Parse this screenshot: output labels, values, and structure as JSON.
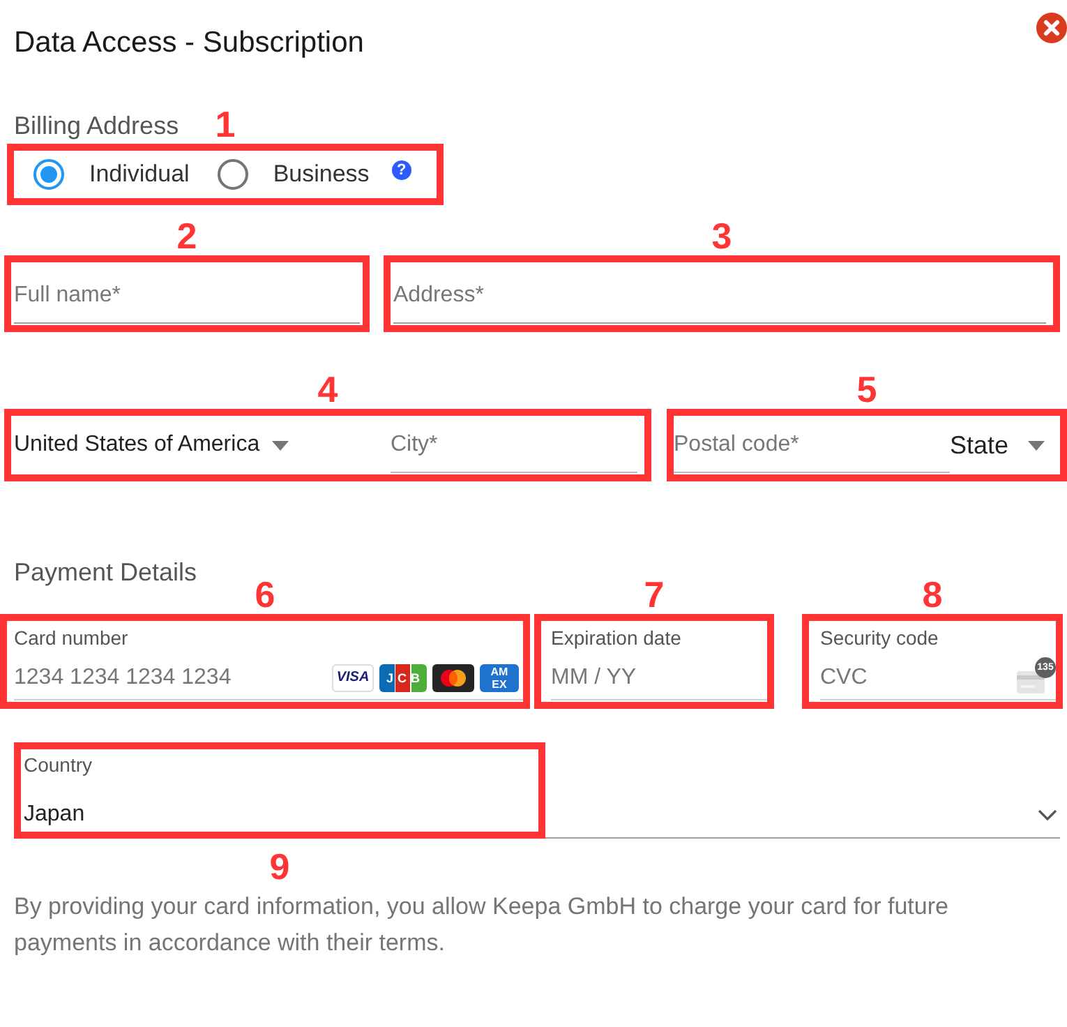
{
  "dialog": {
    "title": "Data Access - Subscription"
  },
  "billing": {
    "heading": "Billing Address",
    "annotation": "1",
    "types": [
      {
        "label": "Individual",
        "selected": true
      },
      {
        "label": "Business",
        "selected": false
      }
    ],
    "help": "?"
  },
  "address_rows": [
    {
      "groups": [
        {
          "annotation": "2",
          "fields": [
            {
              "kind": "text",
              "placeholder": "Full name*"
            }
          ]
        },
        {
          "annotation": "3",
          "fields": [
            {
              "kind": "text",
              "placeholder": "Address*"
            }
          ]
        }
      ]
    },
    {
      "groups": [
        {
          "annotation": "4",
          "fields": [
            {
              "kind": "select",
              "value": "United States of America"
            },
            {
              "kind": "text",
              "placeholder": "City*"
            }
          ]
        },
        {
          "annotation": "5",
          "fields": [
            {
              "kind": "text",
              "placeholder": "Postal code*"
            },
            {
              "kind": "select",
              "value": "State"
            }
          ]
        }
      ]
    }
  ],
  "payment": {
    "heading": "Payment Details",
    "fields": [
      {
        "kind": "card",
        "label": "Card number",
        "placeholder": "1234 1234 1234 1234",
        "annotation": "6",
        "brands": [
          {
            "kind": "visa",
            "text": "VISA"
          },
          {
            "kind": "jcb",
            "text": "JCB"
          },
          {
            "kind": "mastercard"
          },
          {
            "kind": "amex",
            "text": "AMEX"
          }
        ]
      },
      {
        "kind": "expiry",
        "label": "Expiration date",
        "placeholder": "MM / YY",
        "annotation": "7"
      },
      {
        "kind": "cvc",
        "label": "Security code",
        "placeholder": "CVC",
        "annotation": "8",
        "badge": "135"
      }
    ],
    "country": {
      "label": "Country",
      "value": "Japan",
      "annotation": "9"
    }
  },
  "notice": "By providing your card information, you allow Keepa GmbH to charge your card for future payments in accordance with their terms."
}
